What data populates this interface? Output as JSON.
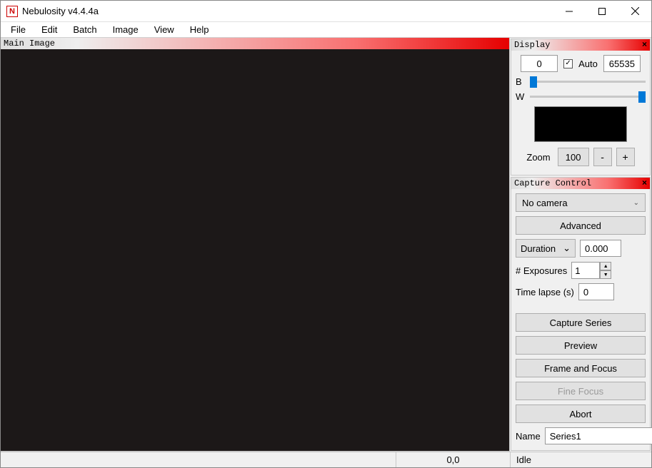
{
  "title": "Nebulosity v4.4.4a",
  "menu": [
    "File",
    "Edit",
    "Batch",
    "Image",
    "View",
    "Help"
  ],
  "main_image_header": "Main Image",
  "display": {
    "header": "Display",
    "black_value": "0",
    "auto_label": "Auto",
    "auto_checked": true,
    "white_value": "65535",
    "b_label": "B",
    "w_label": "W",
    "zoom_label": "Zoom",
    "zoom_value": "100",
    "minus": "-",
    "plus": "+"
  },
  "capture": {
    "header": "Capture Control",
    "camera": "No camera",
    "advanced": "Advanced",
    "duration_label": "Duration",
    "duration_value": "0.000",
    "exposures_label": "# Exposures",
    "exposures_value": "1",
    "timelapse_label": "Time lapse (s)",
    "timelapse_value": "0",
    "capture_series": "Capture Series",
    "preview": "Preview",
    "frame_focus": "Frame and Focus",
    "fine_focus": "Fine Focus",
    "abort": "Abort",
    "name_label": "Name",
    "name_value": "Series1"
  },
  "status": {
    "coords": "0,0",
    "state": "Idle"
  }
}
